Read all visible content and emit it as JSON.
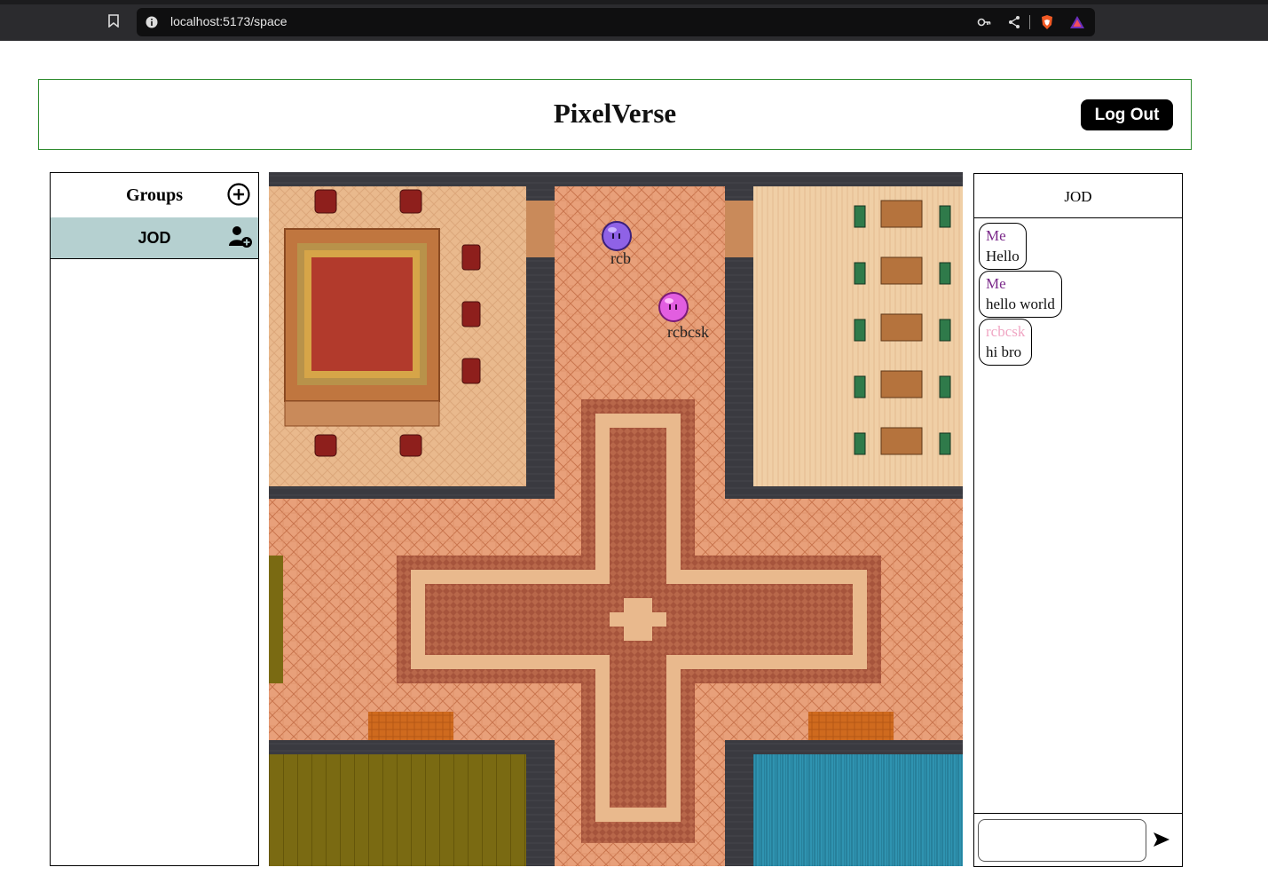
{
  "browser": {
    "url": "localhost:5173/space"
  },
  "header": {
    "title": "PixelVerse",
    "logout_label": "Log Out"
  },
  "groups_panel": {
    "title": "Groups",
    "items": [
      {
        "name": "JOD",
        "selected": true
      }
    ]
  },
  "map": {
    "players": [
      {
        "name": "rcb",
        "color": "#8f62e6"
      },
      {
        "name": "rcbcsk",
        "color": "#e25ee0"
      }
    ]
  },
  "chat": {
    "title": "JOD",
    "messages": [
      {
        "author": "Me",
        "text": "Hello",
        "author_color": "#7b2a8a"
      },
      {
        "author": "Me",
        "text": "hello world",
        "author_color": "#7b2a8a"
      },
      {
        "author": "rcbcsk",
        "text": "hi bro",
        "author_color": "#f0a7c4"
      }
    ],
    "input_value": "",
    "input_placeholder": ""
  },
  "colors": {
    "header_border": "#2e8b2e",
    "group_selected_bg": "#b5d0d0",
    "button_bg": "#000000"
  }
}
